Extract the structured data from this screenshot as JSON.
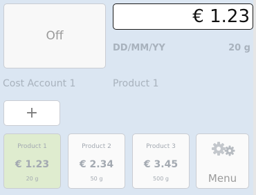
{
  "power": {
    "label": "Off"
  },
  "display": {
    "price": "€ 1.23",
    "date_format": "DD/MM/YY",
    "weight": "20 g"
  },
  "selection": {
    "cost_account": "Cost Account 1",
    "product": "Product 1"
  },
  "add_button": {
    "label": "+"
  },
  "products": [
    {
      "name": "Product 1",
      "price": "€ 1.23",
      "weight": "20 g",
      "selected": true
    },
    {
      "name": "Product 2",
      "price": "€ 2.34",
      "weight": "50 g",
      "selected": false
    },
    {
      "name": "Product 3",
      "price": "€ 3.45",
      "weight": "500 g",
      "selected": false
    }
  ],
  "menu": {
    "label": "Menu",
    "icon": "gears-icon"
  },
  "colors": {
    "background": "#dbe6f2",
    "selected_tile": "#dfeccf",
    "muted_text": "#a8b2bd"
  }
}
